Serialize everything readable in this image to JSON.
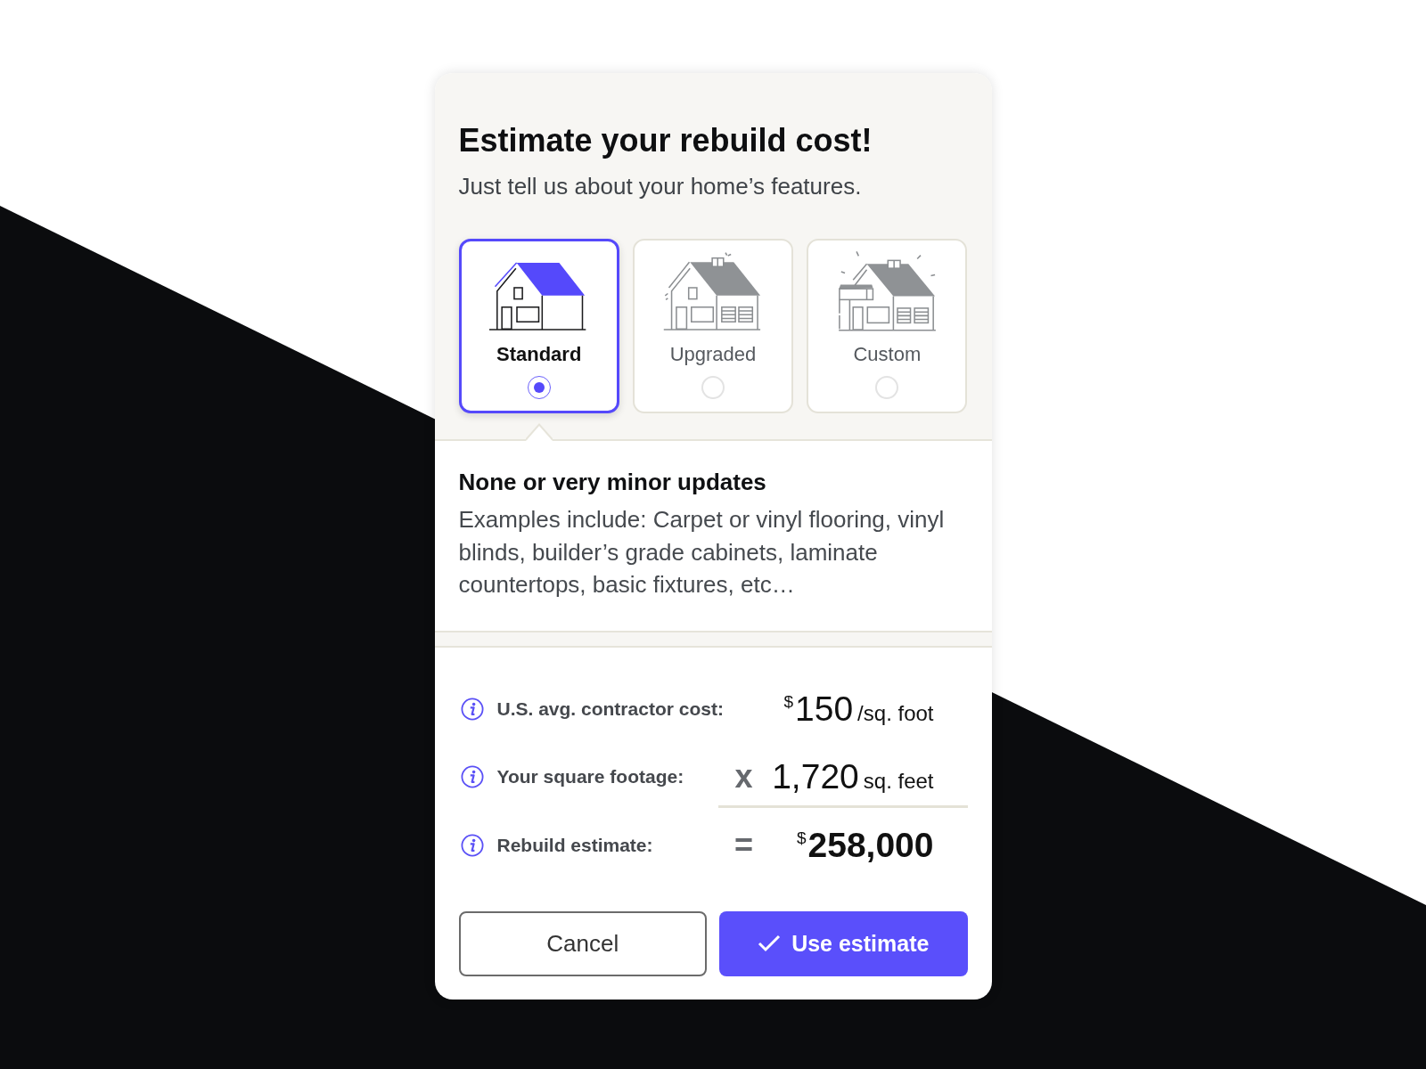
{
  "dialog": {
    "title": "Estimate your rebuild cost!",
    "subtitle": "Just tell us about your home’s features."
  },
  "options": [
    {
      "kind": "standard",
      "label": "Standard",
      "selected": true
    },
    {
      "kind": "upgraded",
      "label": "Upgraded",
      "selected": false
    },
    {
      "kind": "custom",
      "label": "Custom",
      "selected": false
    }
  ],
  "description": {
    "heading": "None or very minor updates",
    "text": "Examples include: Carpet or vinyl flooring, vinyl blinds, builder’s grade cabinets, laminate countertops, basic fixtures, etc…"
  },
  "calculation": [
    {
      "kind": "rate",
      "label": "U.S. avg. contractor cost:",
      "currency": "$",
      "amount": "150",
      "unit": "/sq. foot"
    },
    {
      "kind": "factor",
      "label": "Your square footage:",
      "operator": "x",
      "amount": "1,720",
      "unit": "sq. feet"
    },
    {
      "kind": "total",
      "label": "Rebuild estimate:",
      "operator": "=",
      "currency": "$",
      "amount": "258,000"
    }
  ],
  "buttons": [
    {
      "kind": "secondary",
      "label": "Cancel"
    },
    {
      "kind": "primary",
      "label": "Use estimate"
    }
  ]
}
